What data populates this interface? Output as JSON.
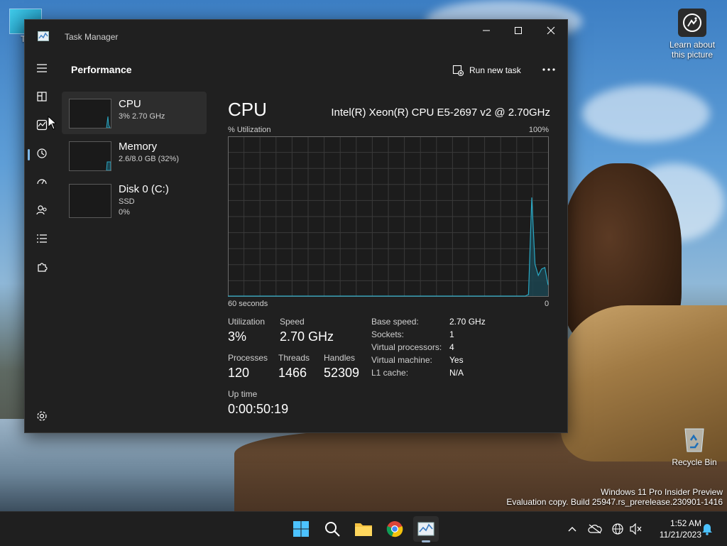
{
  "desktop": {
    "this_pc_label": "Th",
    "learn_label": "Learn about this picture",
    "recycle_label": "Recycle Bin",
    "watermark_line1": "Windows 11 Pro Insider Preview",
    "watermark_line2": "Evaluation copy. Build 25947.rs_prerelease.230901-1416"
  },
  "window": {
    "title": "Task Manager",
    "page_title": "Performance",
    "run_task_label": "Run new task"
  },
  "sidebar": [
    {
      "name": "CPU",
      "sub1": "3%  2.70 GHz",
      "sub2": ""
    },
    {
      "name": "Memory",
      "sub1": "2.6/8.0 GB (32%)",
      "sub2": ""
    },
    {
      "name": "Disk 0 (C:)",
      "sub1": "SSD",
      "sub2": "0%"
    }
  ],
  "cpu": {
    "title": "CPU",
    "model": "Intel(R) Xeon(R) CPU E5-2697 v2 @ 2.70GHz",
    "graph_label": "% Utilization",
    "graph_max": "100%",
    "graph_time": "60 seconds",
    "graph_min": "0",
    "stats": {
      "utilization_label": "Utilization",
      "utilization": "3%",
      "speed_label": "Speed",
      "speed": "2.70 GHz",
      "processes_label": "Processes",
      "processes": "120",
      "threads_label": "Threads",
      "threads": "1466",
      "handles_label": "Handles",
      "handles": "52309",
      "uptime_label": "Up time",
      "uptime": "0:00:50:19"
    },
    "details": [
      {
        "k": "Base speed:",
        "v": "2.70 GHz"
      },
      {
        "k": "Sockets:",
        "v": "1"
      },
      {
        "k": "Virtual processors:",
        "v": "4"
      },
      {
        "k": "Virtual machine:",
        "v": "Yes"
      },
      {
        "k": "L1 cache:",
        "v": "N/A"
      }
    ],
    "history_percent": [
      0,
      0,
      0,
      0,
      0,
      0,
      0,
      0,
      0,
      0,
      0,
      0,
      0,
      0,
      0,
      0,
      0,
      0,
      0,
      0,
      0,
      0,
      0,
      0,
      0,
      0,
      0,
      0,
      0,
      0,
      0,
      0,
      0,
      0,
      0,
      0,
      0,
      0,
      0,
      0,
      0,
      0,
      0,
      0,
      0,
      0,
      0,
      0,
      0,
      0,
      0,
      0,
      0,
      0,
      0,
      0,
      0,
      0,
      0,
      0,
      0,
      0,
      0,
      0,
      0,
      0,
      0,
      0,
      0,
      0,
      0,
      0,
      0,
      0,
      0,
      0,
      0,
      0,
      0,
      0,
      0,
      0,
      0,
      0,
      0,
      0,
      0,
      0,
      0,
      0,
      0,
      0,
      1,
      62,
      20,
      13,
      17,
      18,
      7
    ]
  },
  "taskbar": {
    "time": "1:52 AM",
    "date": "11/21/2023"
  },
  "colors": {
    "graph_line": "#2aa7c2",
    "graph_fill": "#1b4450",
    "grid": "#3a3a3a"
  }
}
